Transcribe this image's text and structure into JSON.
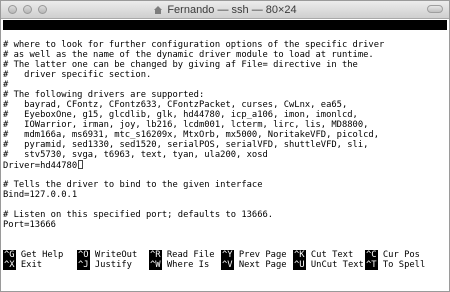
{
  "window": {
    "title": "Fernando — ssh — 80×24"
  },
  "nano": {
    "version_label": "GNU nano 2.3.1",
    "file_label": "File: LCDd.conf"
  },
  "content_lines": [
    "# where to look for further configuration options of the specific driver",
    "# as well as the name of the dynamic driver module to load at runtime.",
    "# The latter one can be changed by giving af File= directive in the",
    "#   driver specific section.",
    "#",
    "# The following drivers are supported:",
    "#   bayrad, CFontz, CFontz633, CFontzPacket, curses, CwLnx, ea65,",
    "#   EyeboxOne, g15, glcdlib, glk, hd44780, icp_a106, imon, imonlcd,",
    "#   IOWarrior, irman, joy, lb216, lcdm001, lcterm, lirc, lis, MD8800,",
    "#   mdm166a, ms6931, mtc_s16209x, MtxOrb, mx5000, NoritakeVFD, picolcd,",
    "#   pyramid, sed1330, sed1520, serialPOS, serialVFD, shuttleVFD, sli,",
    "#   stv5730, svga, t6963, text, tyan, ula200, xosd",
    "Driver=hd44780",
    "",
    "# Tells the driver to bind to the given interface",
    "Bind=127.0.0.1",
    "",
    "# Listen on this specified port; defaults to 13666.",
    "Port=13666"
  ],
  "shortcuts_row1": [
    {
      "key": "^G",
      "label": "Get Help"
    },
    {
      "key": "^O",
      "label": "WriteOut"
    },
    {
      "key": "^R",
      "label": "Read File"
    },
    {
      "key": "^Y",
      "label": "Prev Page"
    },
    {
      "key": "^K",
      "label": "Cut Text"
    },
    {
      "key": "^C",
      "label": "Cur Pos"
    }
  ],
  "shortcuts_row2": [
    {
      "key": "^X",
      "label": "Exit"
    },
    {
      "key": "^J",
      "label": "Justify"
    },
    {
      "key": "^W",
      "label": "Where Is"
    },
    {
      "key": "^V",
      "label": "Next Page"
    },
    {
      "key": "^U",
      "label": "UnCut Text"
    },
    {
      "key": "^T",
      "label": "To Spell"
    }
  ]
}
